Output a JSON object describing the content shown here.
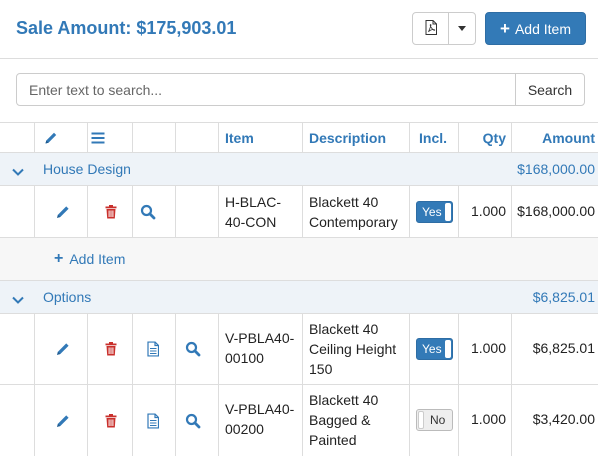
{
  "header": {
    "title": "Sale Amount: $175,903.01",
    "pdf_icon": "file-pdf-icon",
    "dropdown_icon": "caret-down-icon",
    "add_item_label": "Add Item"
  },
  "search": {
    "placeholder": "Enter text to search...",
    "button_label": "Search"
  },
  "columns": {
    "edit_icon": "pencil-icon",
    "menu_icon": "bars-icon",
    "item": "Item",
    "description": "Description",
    "incl": "Incl.",
    "qty": "Qty",
    "amount": "Amount"
  },
  "groups": [
    {
      "name": "House Design",
      "total": "$168,000.00",
      "add_item_label": "Add Item",
      "items": [
        {
          "code": [
            "H-BLAC-",
            "40-CON"
          ],
          "description": [
            "Blackett 40",
            "Contemporary"
          ],
          "included": "Yes",
          "qty": "1.000",
          "amount": "$168,000.00"
        }
      ]
    },
    {
      "name": "Options",
      "total": "$6,825.01",
      "items": [
        {
          "code": [
            "V-PBLA40-",
            "00100"
          ],
          "description": [
            "Blackett 40",
            "Ceiling Height",
            "150"
          ],
          "included": "Yes",
          "qty": "1.000",
          "amount": "$6,825.01"
        },
        {
          "code": [
            "V-PBLA40-",
            "00200"
          ],
          "description": [
            "Blackett 40",
            "Bagged &",
            "Painted"
          ],
          "included": "No",
          "qty": "1.000",
          "amount": "$3,420.00"
        }
      ]
    }
  ],
  "colors": {
    "accent": "#3279b7",
    "primary_button": "#337ab7",
    "delete_red": "#c9302c",
    "group_background": "#eef3f8"
  }
}
